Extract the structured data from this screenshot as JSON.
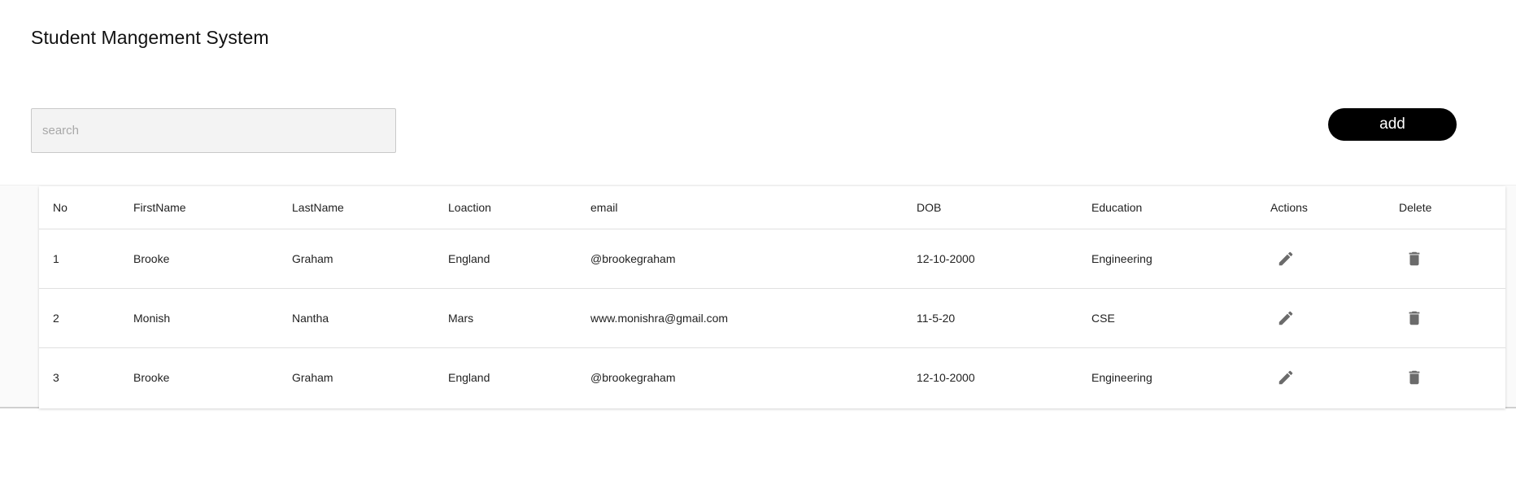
{
  "header": {
    "title": "Student Mangement System"
  },
  "search": {
    "placeholder": "search",
    "value": ""
  },
  "toolbar": {
    "add_label": "add"
  },
  "table": {
    "columns": [
      "No",
      "FirstName",
      "LastName",
      "Loaction",
      "email",
      "DOB",
      "Education",
      "Actions",
      "Delete"
    ],
    "rows": [
      {
        "no": "1",
        "first_name": "Brooke",
        "last_name": "Graham",
        "location": "England",
        "email": "@brookegraham",
        "dob": "12-10-2000",
        "education": "Engineering",
        "action_icon": "edit-icon",
        "delete_icon": "trash-icon"
      },
      {
        "no": "2",
        "first_name": "Monish",
        "last_name": "Nantha",
        "location": "Mars",
        "email": "www.monishra@gmail.com",
        "dob": "11-5-20",
        "education": "CSE",
        "action_icon": "edit-icon",
        "delete_icon": "trash-icon"
      },
      {
        "no": "3",
        "first_name": "Brooke",
        "last_name": "Graham",
        "location": "England",
        "email": "@brookegraham",
        "dob": "12-10-2000",
        "education": "Engineering",
        "action_icon": "edit-icon",
        "delete_icon": "trash-icon"
      }
    ]
  },
  "colors": {
    "accent": "#000000",
    "icon": "#6b6b6b",
    "search_bg": "#f3f3f3"
  }
}
